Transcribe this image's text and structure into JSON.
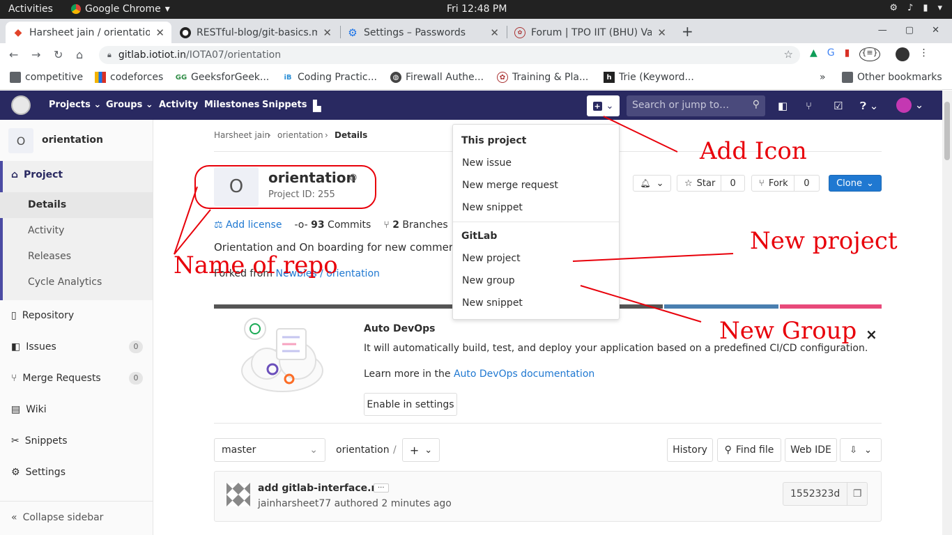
{
  "os": {
    "activities": "Activities",
    "app": "Google Chrome",
    "clock": "Fri 12:48 PM"
  },
  "tabs": [
    {
      "title": "Harsheet jain / orientation",
      "icon": "gitlab-icon"
    },
    {
      "title": "RESTful-blog/git-basics.m",
      "icon": "github-icon"
    },
    {
      "title": "Settings – Passwords",
      "icon": "settings-icon"
    },
    {
      "title": "Forum | TPO IIT (BHU) Var",
      "icon": "forum-icon"
    }
  ],
  "url": {
    "host": "gitlab.iotiot.in",
    "path": "/IOTA07/orientation"
  },
  "bookmarks": [
    {
      "label": "competitive",
      "icon": "folder-icon"
    },
    {
      "label": "codeforces",
      "icon": "codeforces-icon"
    },
    {
      "label": "GeeksforGeek...",
      "icon": "gfg-icon"
    },
    {
      "label": "Coding Practic...",
      "icon": "interviewbit-icon"
    },
    {
      "label": "Firewall Authe...",
      "icon": "globe-icon"
    },
    {
      "label": "Training & Pla...",
      "icon": "tpo-icon"
    },
    {
      "label": "Trie (Keyword...",
      "icon": "h-icon"
    }
  ],
  "bookmarks_more": "»",
  "other_bookmarks": "Other bookmarks",
  "glnav": {
    "projects": "Projects",
    "groups": "Groups",
    "activity": "Activity",
    "milestones": "Milestones",
    "snippets": "Snippets"
  },
  "search_placeholder": "Search or jump to…",
  "sidebar": {
    "project_initial": "O",
    "project_name": "orientation",
    "project": "Project",
    "details": "Details",
    "activity": "Activity",
    "releases": "Releases",
    "cycle": "Cycle Analytics",
    "repository": "Repository",
    "issues": "Issues",
    "issues_count": "0",
    "merge": "Merge Requests",
    "merge_count": "0",
    "wiki": "Wiki",
    "snippets": "Snippets",
    "settings": "Settings",
    "collapse": "Collapse sidebar"
  },
  "breadcrumb": {
    "a": "Harsheet jain",
    "b": "orientation",
    "c": "Details"
  },
  "project": {
    "initial": "O",
    "name": "orientation",
    "id": "Project ID: 255",
    "add_license": "Add license",
    "commits": "93",
    "commits_label": " Commits",
    "branches": "2",
    "branches_label": " Branches",
    "description": "Orientation and On boarding for new commers",
    "forked_from": "Forked from ",
    "fork_source": "Newbies / orientation",
    "star": "Star",
    "star_count": "0",
    "fork": "Fork",
    "fork_count": "0",
    "clone": "Clone"
  },
  "dropdown": {
    "section1": "This project",
    "new_issue": "New issue",
    "new_mr": "New merge request",
    "new_snippet": "New snippet",
    "section2": "GitLab",
    "new_project": "New project",
    "new_group": "New group",
    "new_snippet2": "New snippet"
  },
  "devops": {
    "title": "Auto DevOps",
    "desc": "It will automatically build, test, and deploy your application based on a predefined CI/CD configuration.",
    "learn": "Learn more in the ",
    "learn_link": "Auto DevOps documentation",
    "enable": "Enable in settings",
    "close": "×"
  },
  "repo": {
    "branch": "master",
    "path": "orientation",
    "slash": "/",
    "history": "History",
    "find": "Find file",
    "webide": "Web IDE"
  },
  "commit": {
    "message": "add gitlab-interface.md",
    "author": "jainharsheet77 authored 2 minutes ago",
    "sha": "1552323d",
    "ellipsis": "···"
  },
  "annotations": {
    "add_icon": "Add  Icon",
    "new_project": "New  project",
    "name_repo": "Name  of  repo",
    "new_group": "New  Group"
  },
  "colors": {
    "gitlab_nav": "#292961",
    "annotation_red": "#e8000a",
    "link": "#1f78d1",
    "clone_btn": "#1f78d1"
  }
}
